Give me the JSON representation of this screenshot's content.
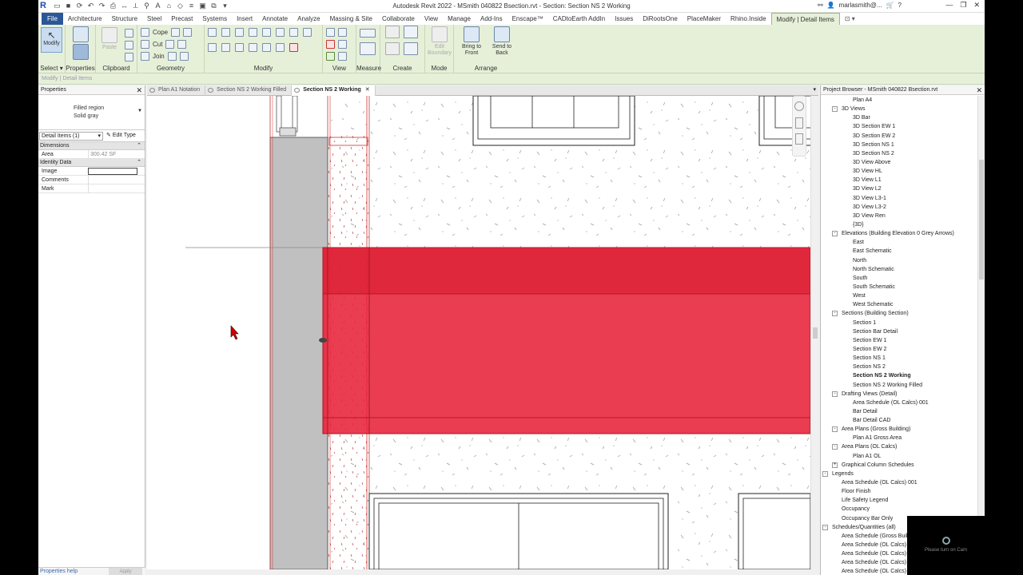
{
  "window": {
    "title": "Autodesk Revit 2022 - MSmith 040822 Bsection.rvt - Section: Section NS 2 Working",
    "user": "marlasmith@...",
    "logo": "R"
  },
  "ribbon_tabs": [
    "File",
    "Architecture",
    "Structure",
    "Steel",
    "Precast",
    "Systems",
    "Insert",
    "Annotate",
    "Analyze",
    "Massing & Site",
    "Collaborate",
    "View",
    "Manage",
    "Add-Ins",
    "Enscape™",
    "CADtoEarth AddIn",
    "Issues",
    "DiRootsOne",
    "PlaceMaker",
    "Rhino.Inside",
    "Modify | Detail Items"
  ],
  "ribbon": {
    "select_label": "Select ▾",
    "modify_label": "Modify",
    "properties_label": "Properties",
    "paste_label": "Paste",
    "cope_label": "Cope",
    "cut_label": "Cut",
    "join_label": "Join",
    "edit_boundary_label": "Edit Boundary",
    "bring_front_label": "Bring to Front",
    "send_back_label": "Send to Back",
    "panels": {
      "clipboard": "Clipboard",
      "geometry": "Geometry",
      "modify": "Modify",
      "view": "View",
      "measure": "Measure",
      "create": "Create",
      "mode": "Mode",
      "arrange": "Arrange"
    }
  },
  "context_bar": "Modify | Detail Items",
  "properties": {
    "title": "Properties",
    "type_name": "Filled region",
    "type_sub": "Solid gray",
    "filter": "Detail Items (1)",
    "edit_type": "Edit Type",
    "groups": [
      {
        "name": "Dimensions",
        "rows": [
          {
            "k": "Area",
            "v": "300.42 SF"
          }
        ]
      },
      {
        "name": "Identity Data",
        "rows": [
          {
            "k": "Image",
            "v": ""
          },
          {
            "k": "Comments",
            "v": ""
          },
          {
            "k": "Mark",
            "v": ""
          }
        ]
      }
    ],
    "help": "Properties help",
    "apply": "Apply"
  },
  "view_tabs": [
    {
      "label": "Plan A1 Notation",
      "active": false
    },
    {
      "label": "Section NS 2 Working Filled",
      "active": false
    },
    {
      "label": "Section NS 2 Working",
      "active": true
    }
  ],
  "project_browser": {
    "title": "Project Browser - MSmith 040822 Bsection.rvt",
    "items": [
      {
        "label": "Plan A4",
        "level": 2
      },
      {
        "label": "3D Views",
        "level": 1,
        "exp": "-"
      },
      {
        "label": "3D Bar",
        "level": 2
      },
      {
        "label": "3D Section EW 1",
        "level": 2
      },
      {
        "label": "3D Section EW 2",
        "level": 2
      },
      {
        "label": "3D Section NS 1",
        "level": 2
      },
      {
        "label": "3D Section NS 2",
        "level": 2
      },
      {
        "label": "3D View Above",
        "level": 2
      },
      {
        "label": "3D View HL",
        "level": 2
      },
      {
        "label": "3D View L1",
        "level": 2
      },
      {
        "label": "3D View L2",
        "level": 2
      },
      {
        "label": "3D View L3-1",
        "level": 2
      },
      {
        "label": "3D View L3-2",
        "level": 2
      },
      {
        "label": "3D View Ren",
        "level": 2
      },
      {
        "label": "{3D}",
        "level": 2
      },
      {
        "label": "Elevations (Building Elevation 0 Grey Arrows)",
        "level": 1,
        "exp": "-"
      },
      {
        "label": "East",
        "level": 2
      },
      {
        "label": "East Schematic",
        "level": 2
      },
      {
        "label": "North",
        "level": 2
      },
      {
        "label": "North Schematic",
        "level": 2
      },
      {
        "label": "South",
        "level": 2
      },
      {
        "label": "South Schematic",
        "level": 2
      },
      {
        "label": "West",
        "level": 2
      },
      {
        "label": "West Schematic",
        "level": 2
      },
      {
        "label": "Sections (Building Section)",
        "level": 1,
        "exp": "-"
      },
      {
        "label": "Section 1",
        "level": 2
      },
      {
        "label": "Section Bar Detail",
        "level": 2
      },
      {
        "label": "Section EW 1",
        "level": 2
      },
      {
        "label": "Section EW 2",
        "level": 2
      },
      {
        "label": "Section NS 1",
        "level": 2
      },
      {
        "label": "Section NS 2",
        "level": 2
      },
      {
        "label": "Section NS 2 Working",
        "level": 2,
        "bold": true
      },
      {
        "label": "Section NS 2 Working Filled",
        "level": 2
      },
      {
        "label": "Drafting Views (Detail)",
        "level": 1,
        "exp": "-"
      },
      {
        "label": "Area Schedule (OL Calcs) 001",
        "level": 2
      },
      {
        "label": "Bar Detail",
        "level": 2
      },
      {
        "label": "Bar Detail CAD",
        "level": 2
      },
      {
        "label": "Area Plans (Gross Building)",
        "level": 1,
        "exp": "-"
      },
      {
        "label": "Plan A1 Gross Area",
        "level": 2
      },
      {
        "label": "Area Plans (OL Calcs)",
        "level": 1,
        "exp": "-"
      },
      {
        "label": "Plan A1 OL",
        "level": 2
      },
      {
        "label": "Graphical Column Schedules",
        "level": 1,
        "exp": "+"
      },
      {
        "label": "Legends",
        "level": 0,
        "exp": "-"
      },
      {
        "label": "Area Schedule (OL Calcs) 001",
        "level": 1
      },
      {
        "label": "Floor Finish",
        "level": 1
      },
      {
        "label": "Life Safety Legend",
        "level": 1
      },
      {
        "label": "Occupancy",
        "level": 1
      },
      {
        "label": "Occupancy Bar Only",
        "level": 1
      },
      {
        "label": "Schedules/Quantities (all)",
        "level": 0,
        "exp": "-"
      },
      {
        "label": "Area Schedule (Gross Building)",
        "level": 1
      },
      {
        "label": "Area Schedule (OL Calcs)",
        "level": 1
      },
      {
        "label": "Area Schedule (OL Calcs)",
        "level": 1
      },
      {
        "label": "Area Schedule (OL Calcs)",
        "level": 1
      },
      {
        "label": "Area Schedule (OL Calcs)",
        "level": 1
      }
    ]
  },
  "webcam": "Please turn on Cam",
  "colors": {
    "accent_ribbon": "#e6f0d9",
    "filled_region": "#e8223a",
    "wall_gray": "#c0c0c0"
  }
}
